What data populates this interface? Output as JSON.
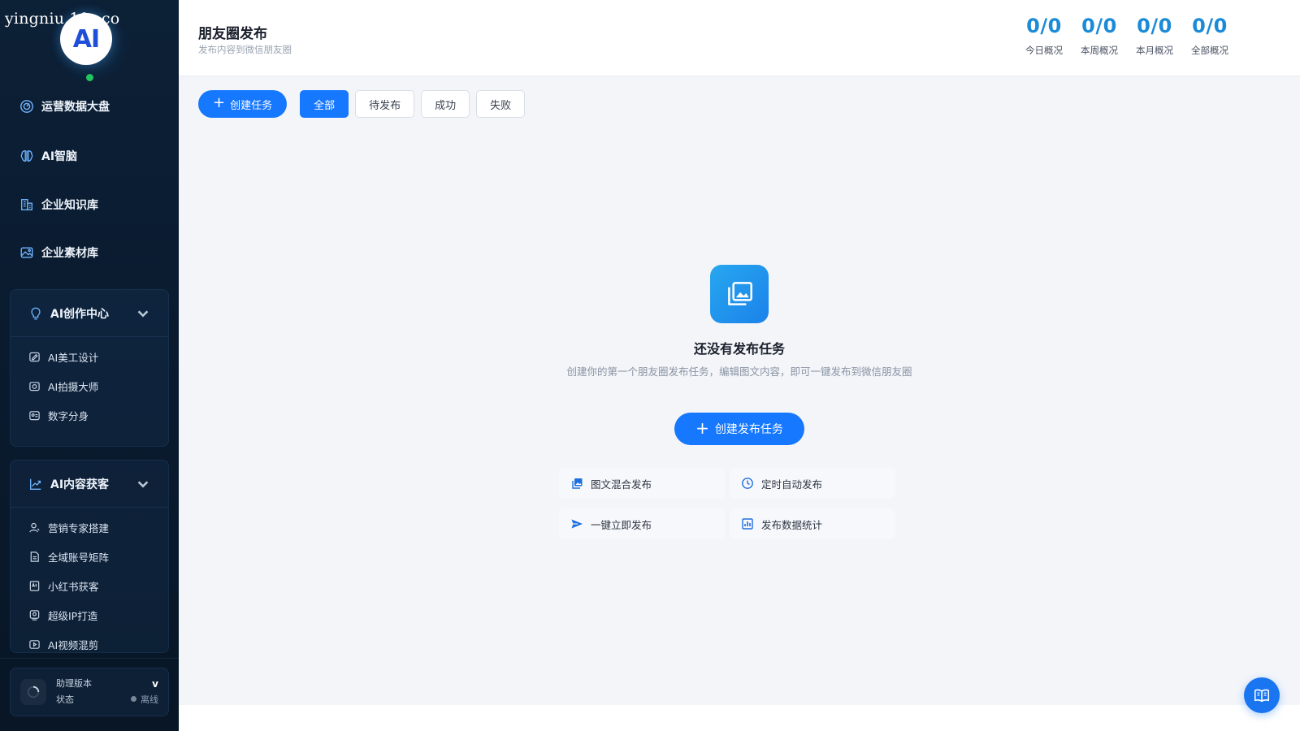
{
  "watermark": "yingniu.10v.co",
  "logo_text": "AI",
  "sidebar": {
    "items": [
      {
        "label": "运营数据大盘",
        "icon": "dashboard-icon"
      },
      {
        "label": "AI智脑",
        "icon": "brain-icon"
      },
      {
        "label": "企业知识库",
        "icon": "building-icon"
      },
      {
        "label": "企业素材库",
        "icon": "image-icon"
      }
    ],
    "groups": [
      {
        "label": "AI创作中心",
        "icon": "lightbulb-icon",
        "items": [
          {
            "label": "AI美工设计",
            "icon": "design-icon"
          },
          {
            "label": "AI拍摄大师",
            "icon": "camera-icon"
          },
          {
            "label": "数字分身",
            "icon": "avatar-icon"
          }
        ]
      },
      {
        "label": "AI内容获客",
        "icon": "trend-icon",
        "items": [
          {
            "label": "营销专家搭建",
            "icon": "user-icon"
          },
          {
            "label": "全域账号矩阵",
            "icon": "document-icon"
          },
          {
            "label": "小红书获客",
            "icon": "ai-box-icon"
          },
          {
            "label": "超级IP打造",
            "icon": "ip-icon"
          },
          {
            "label": "AI视频混剪",
            "icon": "video-icon"
          }
        ]
      }
    ],
    "assistant": {
      "title": "助理版本",
      "version": "v",
      "status_label": "状态",
      "status_value": "离线"
    }
  },
  "header": {
    "title": "朋友圈发布",
    "subtitle": "发布内容到微信朋友圈",
    "stats": [
      {
        "value": "0/0",
        "label": "今日概况"
      },
      {
        "value": "0/0",
        "label": "本周概况"
      },
      {
        "value": "0/0",
        "label": "本月概况"
      },
      {
        "value": "0/0",
        "label": "全部概况"
      }
    ]
  },
  "toolbar": {
    "create_label": "创建任务",
    "tabs": [
      "全部",
      "待发布",
      "成功",
      "失败"
    ],
    "active_tab": "全部"
  },
  "empty_state": {
    "title": "还没有发布任务",
    "description": "创建你的第一个朋友圈发布任务，编辑图文内容，即可一键发布到微信朋友圈",
    "button_label": "创建发布任务",
    "features": [
      {
        "label": "图文混合发布",
        "icon": "image-text-icon"
      },
      {
        "label": "定时自动发布",
        "icon": "clock-icon"
      },
      {
        "label": "一键立即发布",
        "icon": "send-icon"
      },
      {
        "label": "发布数据统计",
        "icon": "bar-chart-icon"
      }
    ]
  },
  "colors": {
    "primary": "#1677ff",
    "stat_value": "#1b8bd8",
    "sidebar_bg": "#0c2036",
    "online": "#22c55e"
  }
}
